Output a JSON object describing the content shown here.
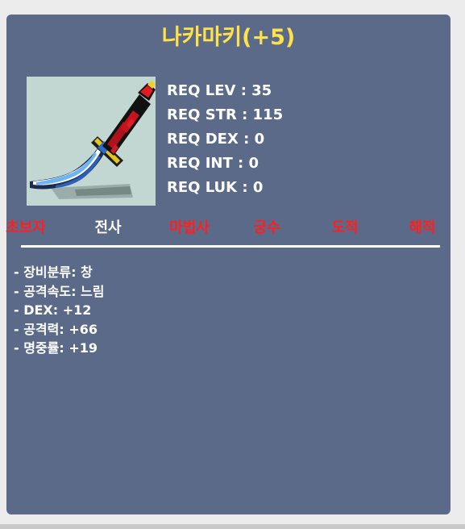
{
  "item": {
    "name": "나카마키(+5)",
    "icon": "curved-spear-blade-icon"
  },
  "requirements": [
    "REQ LEV : 35",
    "REQ STR : 115",
    "REQ DEX : 0",
    "REQ INT : 0",
    "REQ LUK : 0"
  ],
  "jobs": [
    {
      "label": "초보자",
      "eligible": false,
      "color": "#ff1f1f"
    },
    {
      "label": "전사",
      "eligible": true,
      "color": "#ffffff"
    },
    {
      "label": "마법사",
      "eligible": false,
      "color": "#ff1f1f"
    },
    {
      "label": "궁수",
      "eligible": false,
      "color": "#ff1f1f"
    },
    {
      "label": "도적",
      "eligible": false,
      "color": "#ff1f1f"
    },
    {
      "label": "해적",
      "eligible": false,
      "color": "#ff1f1f"
    }
  ],
  "stats": [
    "- 장비분류: 창",
    "- 공격속도: 느림",
    "- DEX: +12",
    "- 공격력: +66",
    "- 명중률: +19"
  ],
  "colors": {
    "title": "#ffe24a",
    "panel": "#5c6a89",
    "icon_bg": "#c2d6d2"
  }
}
